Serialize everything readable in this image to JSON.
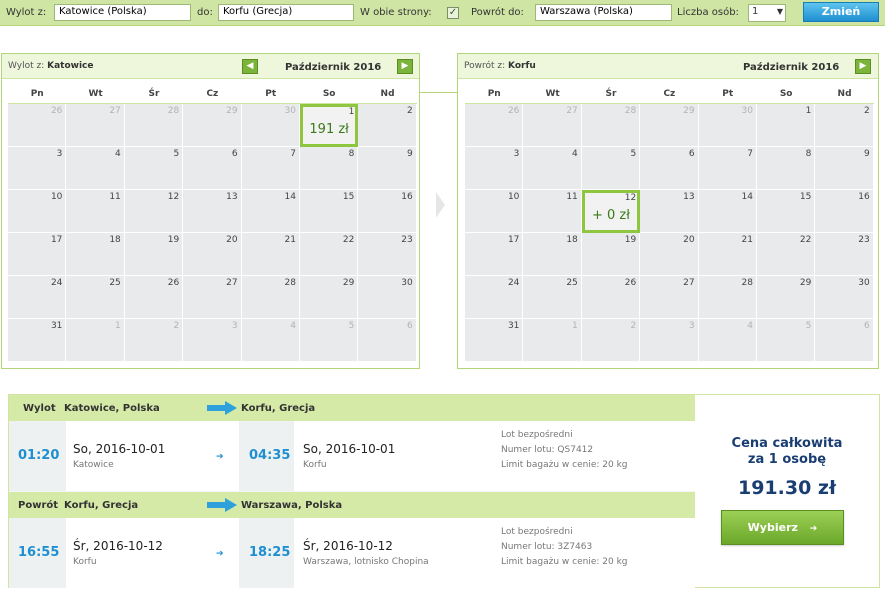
{
  "search": {
    "from_label": "Wylot z:",
    "from_value": "Katowice (Polska)",
    "to_label": "do:",
    "to_value": "Korfu (Grecja)",
    "roundtrip_label": "W obie strony:",
    "roundtrip_checked": "✓",
    "return_label": "Powrót do:",
    "return_value": "Warszawa (Polska)",
    "passengers_label": "Liczba osób:",
    "passengers_value": "1",
    "submit_label": "Zmień"
  },
  "calendar_out": {
    "from_label": "Wylot z:",
    "from_city": "Katowice",
    "month": "Październik 2016",
    "prev_icon": "arrow-left-icon",
    "next_icon": "arrow-right-icon",
    "weekdays": [
      "Pn",
      "Wt",
      "Śr",
      "Cz",
      "Pt",
      "So",
      "Nd"
    ],
    "selected_day": "1",
    "selected_price": "191 zł",
    "days": [
      "26",
      "27",
      "28",
      "29",
      "30",
      "1",
      "2",
      "3",
      "4",
      "5",
      "6",
      "7",
      "8",
      "9",
      "10",
      "11",
      "12",
      "13",
      "14",
      "15",
      "16",
      "17",
      "18",
      "19",
      "20",
      "21",
      "22",
      "23",
      "24",
      "25",
      "26",
      "27",
      "28",
      "29",
      "30",
      "31",
      "1",
      "2",
      "3",
      "4",
      "5",
      "6"
    ]
  },
  "calendar_ret": {
    "from_label": "Powrót z:",
    "from_city": "Korfu",
    "month": "Październik 2016",
    "weekdays": [
      "Pn",
      "Wt",
      "Śr",
      "Cz",
      "Pt",
      "So",
      "Nd"
    ],
    "selected_day": "12",
    "selected_price": "+ 0 zł",
    "days": [
      "26",
      "27",
      "28",
      "29",
      "30",
      "1",
      "2",
      "3",
      "4",
      "5",
      "6",
      "7",
      "8",
      "9",
      "10",
      "11",
      "12",
      "13",
      "14",
      "15",
      "16",
      "17",
      "18",
      "19",
      "20",
      "21",
      "22",
      "23",
      "24",
      "25",
      "26",
      "27",
      "28",
      "29",
      "30",
      "31",
      "1",
      "2",
      "3",
      "4",
      "5",
      "6"
    ]
  },
  "summary": {
    "outbound": {
      "label": "Wylot",
      "from": "Katowice, Polska",
      "to": "Korfu, Grecja",
      "dep_time": "01:20",
      "dep_date": "So, 2016-10-01",
      "dep_city": "Katowice",
      "arr_time": "04:35",
      "arr_date": "So, 2016-10-01",
      "arr_city": "Korfu",
      "info1": "Lot bezpośredni",
      "info2": "Numer lotu: QS7412",
      "info3": "Limit bagażu w cenie: 20 kg"
    },
    "return": {
      "label": "Powrót",
      "from": "Korfu, Grecja",
      "to": "Warszawa, Polska",
      "dep_time": "16:55",
      "dep_date": "Śr, 2016-10-12",
      "dep_city": "Korfu",
      "arr_time": "18:25",
      "arr_date": "Śr, 2016-10-12",
      "arr_city": "Warszawa, lotnisko Chopina",
      "info1": "Lot bezpośredni",
      "info2": "Numer lotu: 3Z7463",
      "info3": "Limit bagażu w cenie: 20 kg"
    },
    "price_title_1": "Cena całkowita",
    "price_title_2": "za 1 osobę",
    "price_total": "191.30 zł",
    "choose_label": "Wybierz",
    "choose_arrow": "➔"
  }
}
